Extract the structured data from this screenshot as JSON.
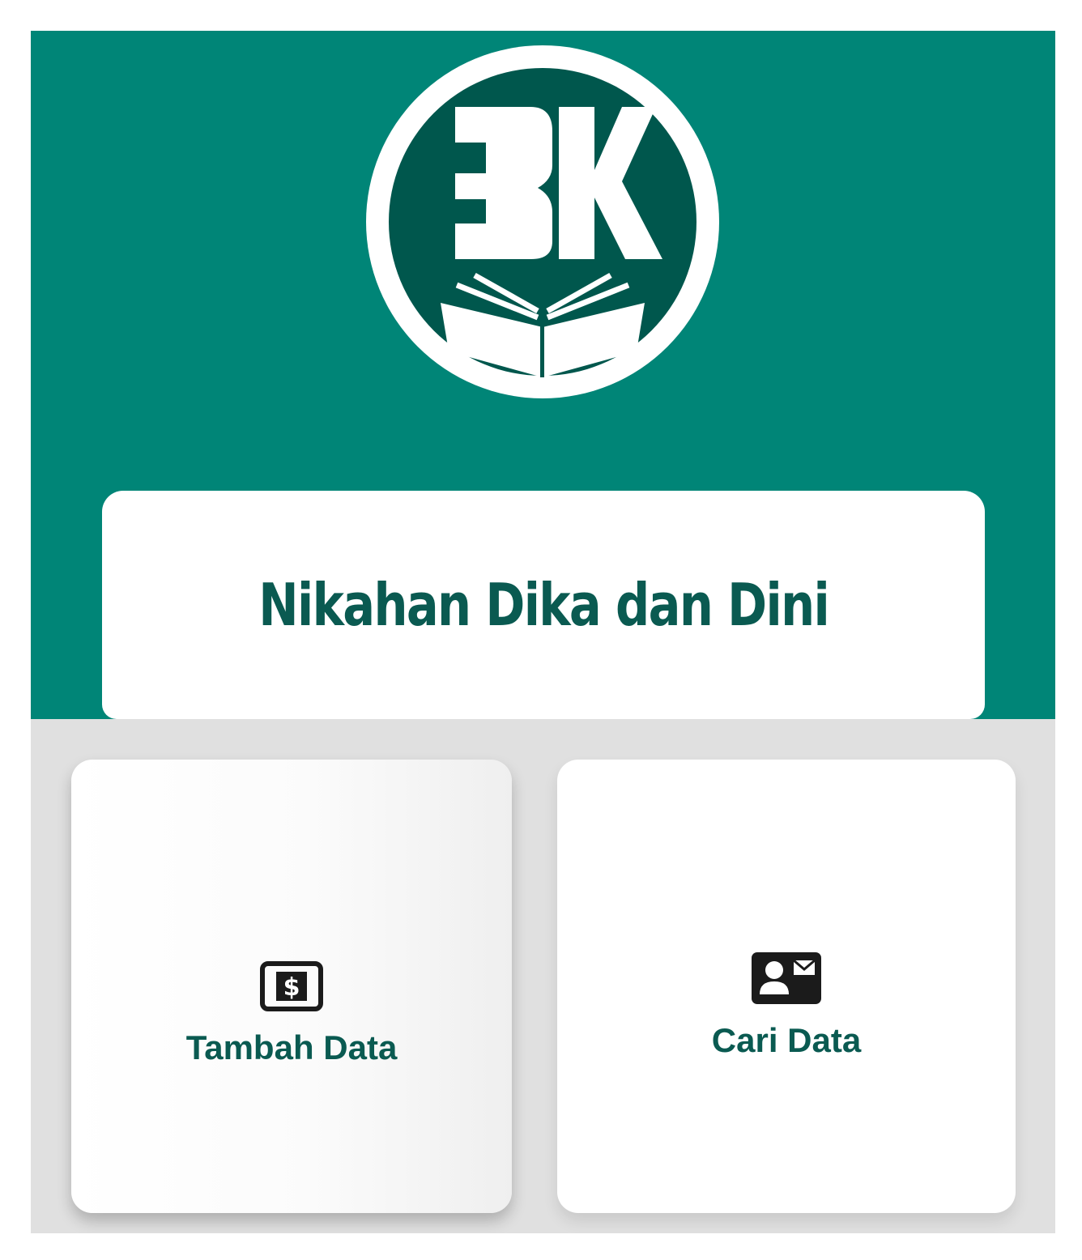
{
  "logo": {
    "letters": "BK",
    "icon": "book-icon",
    "colors": {
      "ring": "#ffffff",
      "disc": "#00574d"
    }
  },
  "title_card": {
    "title": "Nikahan Dika dan Dini"
  },
  "menu": [
    {
      "label": "Tambah Data",
      "icon": "money-card-icon"
    },
    {
      "label": "Cari Data",
      "icon": "contact-card-icon"
    }
  ],
  "colors": {
    "header_bg": "#008577",
    "accent_text": "#0a5a51",
    "page_bg": "#e0e0e0",
    "card_bg": "#ffffff"
  }
}
